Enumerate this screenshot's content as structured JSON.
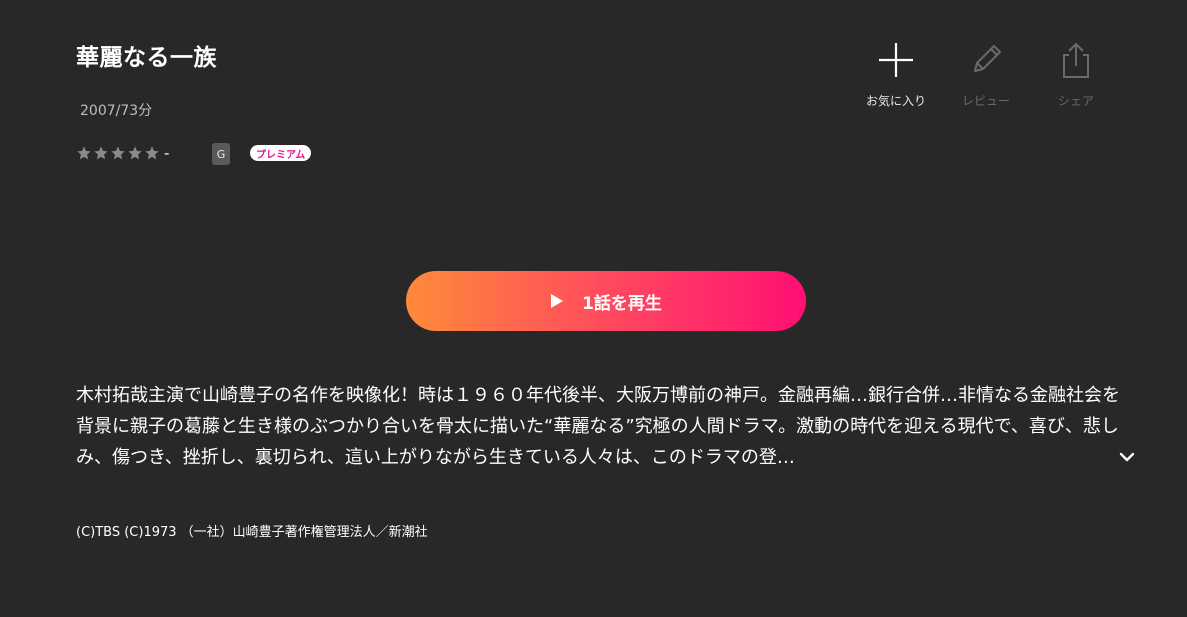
{
  "title": "華麗なる一族",
  "meta": "2007/73分",
  "rating": {
    "stars_filled": 0,
    "stars_total": 5,
    "value": "-"
  },
  "age_rating": "G",
  "premium_badge": "プレミアム",
  "actions": {
    "favorite_label": "お気に入り",
    "review_label": "レビュー",
    "share_label": "シェア"
  },
  "play_button": {
    "label": "1話を再生"
  },
  "description": "木村拓哉主演で山崎豊子の名作を映像化！時は１９６０年代後半、大阪万博前の神戸。金融再編…銀行合併…非情なる金融社会を背景に親子の葛藤と生き様のぶつかり合いを骨太に描いた“華麗なる”究極の人間ドラマ。激動の時代を迎える現代で、喜び、悲しみ、傷つき、挫折し、裏切られ、這い上がりながら生きている人々は、このドラマの登…",
  "copyright": "(C)TBS (C)1973 （一社）山崎豊子著作権管理法人／新潮社",
  "colors": {
    "background": "#282828",
    "gradient_start": "#ff8a3a",
    "gradient_end": "#ff0f73",
    "star_empty": "#8a8a8a",
    "premium_text": "#e8138a"
  },
  "icons": {
    "favorite": "plus-icon",
    "review": "pencil-icon",
    "share": "share-icon",
    "play": "play-icon",
    "expand": "chevron-down-icon"
  }
}
